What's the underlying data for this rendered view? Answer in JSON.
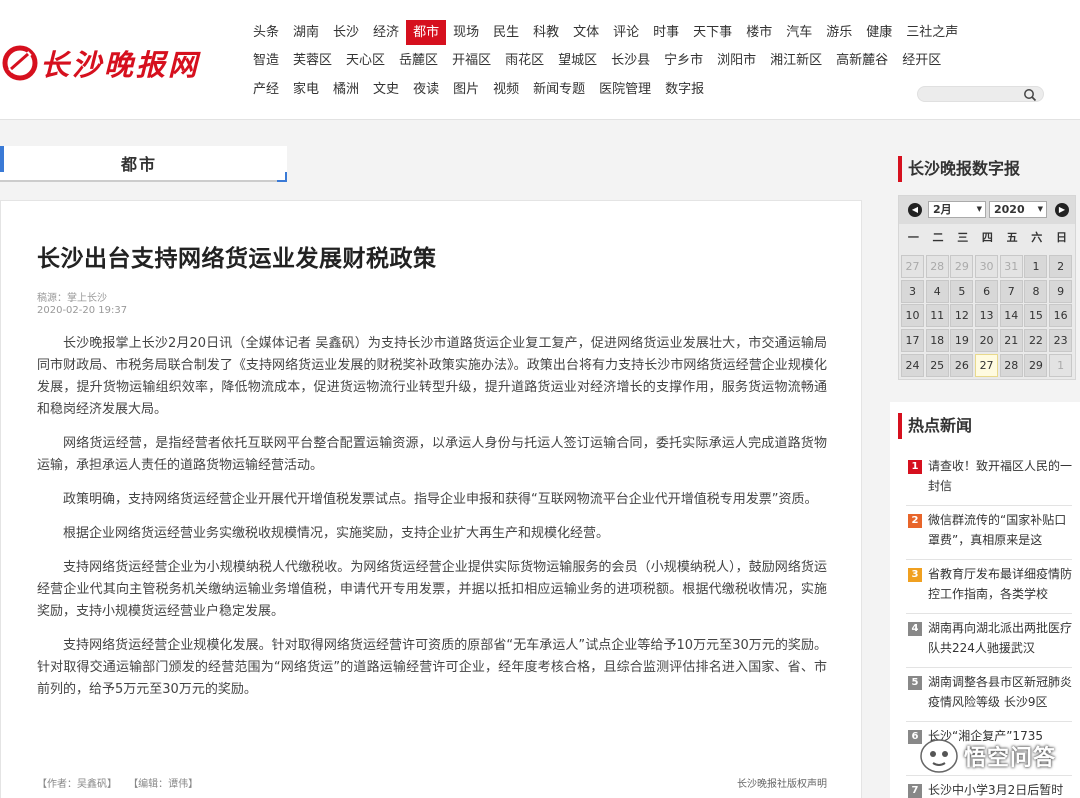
{
  "header": {
    "logo_text": "长沙晚报网",
    "nav_rows": [
      [
        "头条",
        "湖南",
        "长沙",
        "经济",
        "都市",
        "现场",
        "民生",
        "科教",
        "文体",
        "评论",
        "时事",
        "天下事",
        "楼市",
        "汽车",
        "游乐",
        "健康",
        "三社之声"
      ],
      [
        "智造",
        "芙蓉区",
        "天心区",
        "岳麓区",
        "开福区",
        "雨花区",
        "望城区",
        "长沙县",
        "宁乡市",
        "浏阳市",
        "湘江新区",
        "高新麓谷",
        "经开区"
      ],
      [
        "产经",
        "家电",
        "橘洲",
        "文史",
        "夜读",
        "图片",
        "视频",
        "新闻专题",
        "医院管理",
        "数字报"
      ]
    ],
    "active_nav": "都市",
    "search_placeholder": ""
  },
  "channel": {
    "label": "都市"
  },
  "article": {
    "title": "长沙出台支持网络货运业发展财税政策",
    "source": "稿源：掌上长沙",
    "date": "2020-02-20 19:37",
    "paragraphs": [
      "长沙晚报掌上长沙2月20日讯（全媒体记者 吴鑫矾）为支持长沙市道路货运企业复工复产，促进网络货运业发展壮大，市交通运输局同市财政局、市税务局联合制发了《支持网络货运业发展的财税奖补政策实施办法》。政策出台将有力支持长沙市网络货运经营企业规模化发展，提升货物运输组织效率，降低物流成本，促进货运物流行业转型升级，提升道路货运业对经济增长的支撑作用，服务货运物流畅通和稳岗经济发展大局。",
      "网络货运经营，是指经营者依托互联网平台整合配置运输资源，以承运人身份与托运人签订运输合同，委托实际承运人完成道路货物运输，承担承运人责任的道路货物运输经营活动。",
      "政策明确，支持网络货运经营企业开展代开增值税发票试点。指导企业申报和获得“互联网物流平台企业代开增值税专用发票”资质。",
      "根据企业网络货运经营业务实缴税收规模情况，实施奖励，支持企业扩大再生产和规模化经营。",
      "支持网络货运经营企业为小规模纳税人代缴税收。为网络货运经营企业提供实际货物运输服务的会员（小规模纳税人），鼓励网络货运经营企业代其向主管税务机关缴纳运输业务增值税，申请代开专用发票，并据以抵扣相应运输业务的进项税额。根据代缴税收情况，实施奖励，支持小规模货运经营业户稳定发展。",
      "支持网络货运经营企业规模化发展。针对取得网络货运经营许可资质的原部省“无车承运人”试点企业等给予10万元至30万元的奖励。针对取得交通运输部门颁发的经营范围为“网络货运”的道路运输经营许可企业，经年度考核合格，且综合监测评估排名进入国家、省、市前列的，给予5万元至30万元的奖励。"
    ],
    "author": "【作者：吴鑫矾】",
    "editor": "【编辑：谭伟】",
    "copyright": "长沙晚报社版权声明"
  },
  "digital_paper": {
    "title": "长沙晚报数字报",
    "month": "2月",
    "year": "2020",
    "weekdays": [
      "一",
      "二",
      "三",
      "四",
      "五",
      "六",
      "日"
    ],
    "days": [
      [
        27,
        28,
        29,
        30,
        31,
        1,
        2
      ],
      [
        3,
        4,
        5,
        6,
        7,
        8,
        9
      ],
      [
        10,
        11,
        12,
        13,
        14,
        15,
        16
      ],
      [
        17,
        18,
        19,
        20,
        21,
        22,
        23
      ],
      [
        24,
        25,
        26,
        27,
        28,
        29,
        1
      ]
    ],
    "today": 27
  },
  "hot_news": {
    "title": "热点新闻",
    "items": [
      {
        "rank": "1",
        "text": "请查收！致开福区人民的一封信",
        "color": "#d6101e"
      },
      {
        "rank": "2",
        "text": "微信群流传的“国家补贴口罩费”，真相原来是这",
        "color": "#e8652a"
      },
      {
        "rank": "3",
        "text": "省教育厅发布最详细疫情防控工作指南，各类学校",
        "color": "#f0a020"
      },
      {
        "rank": "4",
        "text": "湖南再向湖北派出两批医疗队共224人驰援武汉",
        "color": "#888888"
      },
      {
        "rank": "5",
        "text": "湖南调整各县市区新冠肺炎疫情风险等级 长沙9区",
        "color": "#888888"
      },
      {
        "rank": "6",
        "text": "长沙“湘企复产”1735",
        "color": "#888888"
      },
      {
        "rank": "7",
        "text": "长沙中小学3月2日后暂时",
        "color": "#888888"
      }
    ]
  },
  "watermark": {
    "text": "悟空问答"
  }
}
